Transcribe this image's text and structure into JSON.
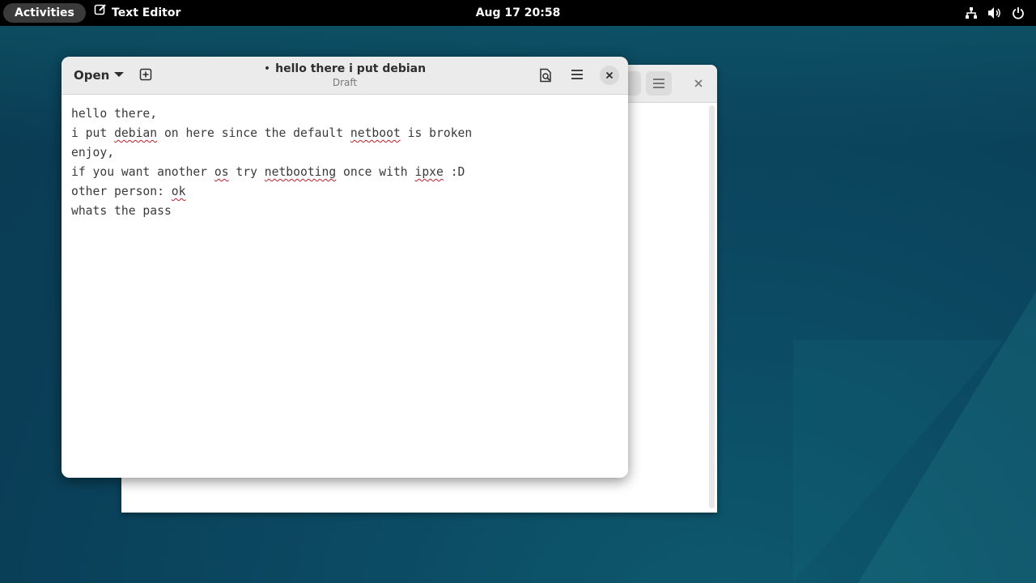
{
  "topbar": {
    "activities": "Activities",
    "app_name": "Text Editor",
    "clock": "Aug 17  20:58",
    "tray_icons": [
      "network-icon",
      "volume-icon",
      "power-icon"
    ]
  },
  "editor_window": {
    "open_label": "Open",
    "title": "hello there i put debian",
    "modified_marker": "•",
    "subtitle": "Draft"
  },
  "document": {
    "lines": [
      {
        "segments": [
          {
            "t": "hello there,",
            "sp": false
          }
        ]
      },
      {
        "segments": [
          {
            "t": "i put ",
            "sp": false
          },
          {
            "t": "debian",
            "sp": true
          },
          {
            "t": " on here since the default ",
            "sp": false
          },
          {
            "t": "netboot",
            "sp": true
          },
          {
            "t": " is broken",
            "sp": false
          }
        ]
      },
      {
        "segments": [
          {
            "t": "enjoy,",
            "sp": false
          }
        ]
      },
      {
        "segments": [
          {
            "t": "if you want another ",
            "sp": false
          },
          {
            "t": "os",
            "sp": true
          },
          {
            "t": " try ",
            "sp": false
          },
          {
            "t": "netbooting",
            "sp": true
          },
          {
            "t": " once with ",
            "sp": false
          },
          {
            "t": "ipxe",
            "sp": true
          },
          {
            "t": " :D",
            "sp": false
          }
        ]
      },
      {
        "segments": [
          {
            "t": "other person: ",
            "sp": false
          },
          {
            "t": "ok",
            "sp": true
          }
        ]
      },
      {
        "segments": [
          {
            "t": "whats the pass",
            "sp": false
          }
        ]
      }
    ]
  },
  "colors": {
    "topbar": "#000000",
    "headerbar": "#ebebeb",
    "spellcheck": "#c01c28",
    "desktop": "#0b4b63"
  }
}
